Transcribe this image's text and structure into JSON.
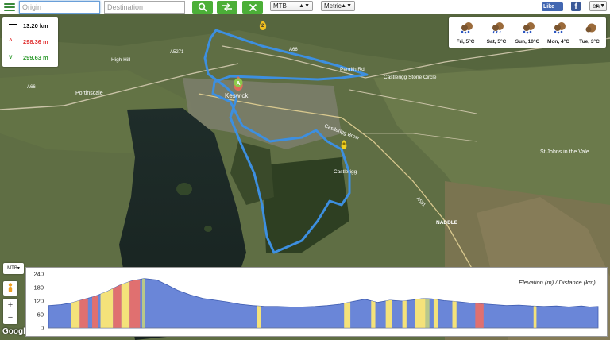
{
  "toolbar": {
    "origin_placeholder": "Origin",
    "destination_placeholder": "Destination",
    "search_icon": "search-icon",
    "swap_icon": "swap-icon",
    "clear_icon": "close-icon",
    "activity_value": "MTB",
    "units_value": "Metric",
    "facebook_like_label": "Like",
    "facebook_icon_label": "f",
    "language_value": "en"
  },
  "stats": {
    "distance": "13.20 km",
    "ascent": "298.36 m",
    "descent": "299.63 m",
    "distance_icon": "minus-icon",
    "ascent_icon": "chevron-up-icon",
    "descent_icon": "chevron-down-icon",
    "ascent_color": "#e03030",
    "descent_color": "#2e9a2e"
  },
  "weather": {
    "days": [
      {
        "label": "Fri, 5°C",
        "icon": "snow-icon"
      },
      {
        "label": "Sat, 5°C",
        "icon": "rain-icon"
      },
      {
        "label": "Sun, 10°C",
        "icon": "snow-icon"
      },
      {
        "label": "Mon, 4°C",
        "icon": "snow-icon"
      },
      {
        "label": "Tue, 3°C",
        "icon": "cloud-icon"
      }
    ]
  },
  "map": {
    "labels": {
      "keswick": "Keswick",
      "castlerigg": "Castlerigg",
      "castlerigg_circle": "Castlerigg Stone Circle",
      "castlerigg_brow": "Castlerigg Brow",
      "high_hill": "High Hill",
      "portinscale": "Portinscale",
      "st_johns": "St Johns in the Vale",
      "naddle": "NADDLE",
      "penrith_rd": "Penrith Rd",
      "a66_a": "A66",
      "a66_b": "A66",
      "a591": "A591",
      "a5271": "A5271"
    },
    "marker_a": "A",
    "marker_b": "2",
    "route_color": "#3d8fe0",
    "mtb_control": "MTB",
    "zoom_in": "+",
    "zoom_out": "−",
    "pegman_icon": "pegman-icon",
    "logo": "Google"
  },
  "elevation": {
    "title": "Elevation (m) / Distance (km)",
    "y_ticks": [
      "240",
      "180",
      "120",
      "60",
      "0"
    ],
    "fill_color": "#6a86d8",
    "profile": [
      [
        0.0,
        100
      ],
      [
        0.3,
        104
      ],
      [
        0.55,
        112
      ],
      [
        0.85,
        128
      ],
      [
        1.1,
        140
      ],
      [
        1.4,
        162
      ],
      [
        1.7,
        190
      ],
      [
        2.0,
        210
      ],
      [
        2.3,
        220
      ],
      [
        2.6,
        214
      ],
      [
        2.85,
        192
      ],
      [
        3.1,
        168
      ],
      [
        3.4,
        148
      ],
      [
        3.7,
        132
      ],
      [
        4.0,
        124
      ],
      [
        4.3,
        116
      ],
      [
        4.6,
        106
      ],
      [
        4.9,
        100
      ],
      [
        5.2,
        96
      ],
      [
        5.5,
        96
      ],
      [
        5.8,
        94
      ],
      [
        6.1,
        94
      ],
      [
        6.4,
        96
      ],
      [
        6.7,
        100
      ],
      [
        7.0,
        106
      ],
      [
        7.3,
        118
      ],
      [
        7.6,
        128
      ],
      [
        7.9,
        114
      ],
      [
        8.2,
        124
      ],
      [
        8.5,
        120
      ],
      [
        8.8,
        126
      ],
      [
        9.0,
        132
      ],
      [
        9.2,
        130
      ],
      [
        9.5,
        122
      ],
      [
        9.8,
        118
      ],
      [
        10.1,
        112
      ],
      [
        10.4,
        108
      ],
      [
        10.7,
        104
      ],
      [
        11.0,
        100
      ],
      [
        11.3,
        102
      ],
      [
        11.6,
        98
      ],
      [
        11.9,
        96
      ],
      [
        12.2,
        98
      ],
      [
        12.5,
        94
      ],
      [
        12.8,
        98
      ],
      [
        13.0,
        94
      ],
      [
        13.2,
        96
      ]
    ],
    "grade_bands": [
      {
        "from": 0.55,
        "to": 0.75,
        "color": "#f4e27a"
      },
      {
        "from": 0.75,
        "to": 0.95,
        "color": "#e07070"
      },
      {
        "from": 1.05,
        "to": 1.2,
        "color": "#e07070"
      },
      {
        "from": 1.25,
        "to": 1.55,
        "color": "#f4e27a"
      },
      {
        "from": 1.55,
        "to": 1.75,
        "color": "#e07070"
      },
      {
        "from": 1.75,
        "to": 1.95,
        "color": "#f4e27a"
      },
      {
        "from": 1.95,
        "to": 2.2,
        "color": "#e07070"
      },
      {
        "from": 2.25,
        "to": 2.32,
        "color": "#b8c88a"
      },
      {
        "from": 5.0,
        "to": 5.1,
        "color": "#f4e27a"
      },
      {
        "from": 7.1,
        "to": 7.25,
        "color": "#f4e27a"
      },
      {
        "from": 7.75,
        "to": 7.85,
        "color": "#f4e27a"
      },
      {
        "from": 8.1,
        "to": 8.25,
        "color": "#f4e27a"
      },
      {
        "from": 8.5,
        "to": 8.6,
        "color": "#f4e27a"
      },
      {
        "from": 8.8,
        "to": 9.05,
        "color": "#f4e27a"
      },
      {
        "from": 9.05,
        "to": 9.15,
        "color": "#b8c88a"
      },
      {
        "from": 9.25,
        "to": 9.35,
        "color": "#f4e27a"
      },
      {
        "from": 9.7,
        "to": 9.8,
        "color": "#f4e27a"
      },
      {
        "from": 10.25,
        "to": 10.45,
        "color": "#e07070"
      },
      {
        "from": 11.65,
        "to": 11.72,
        "color": "#f4e27a"
      }
    ],
    "x_max": 13.2,
    "y_max": 240
  }
}
